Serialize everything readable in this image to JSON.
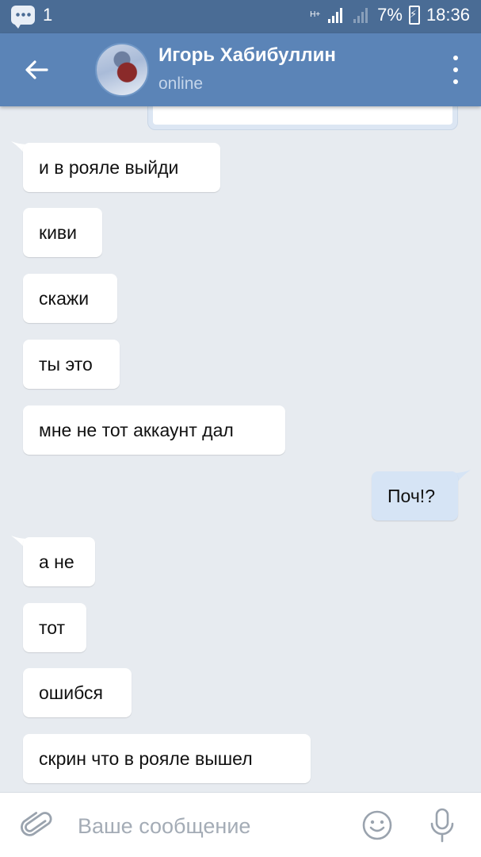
{
  "status_bar": {
    "notification_count": "1",
    "network_type": "H+",
    "battery": "7%",
    "time": "18:36"
  },
  "header": {
    "contact_name": "Игорь Хабибуллин",
    "contact_status": "online"
  },
  "messages": [
    {
      "side": "in",
      "text": "и в рояле выйди"
    },
    {
      "side": "in",
      "text": "киви"
    },
    {
      "side": "in",
      "text": "скажи"
    },
    {
      "side": "in",
      "text": "ты это"
    },
    {
      "side": "in",
      "text": "мне не тот аккаунт дал"
    },
    {
      "side": "out",
      "text": "Поч!?"
    },
    {
      "side": "in",
      "text": "а не"
    },
    {
      "side": "in",
      "text": "тот"
    },
    {
      "side": "in",
      "text": "ошибся"
    },
    {
      "side": "in",
      "text": "скрин что в рояле вышел"
    }
  ],
  "composer": {
    "placeholder": "Ваше сообщение"
  },
  "colors": {
    "status_bar": "#4a6c95",
    "toolbar": "#5b84b7",
    "chat_background": "#e7ebf0",
    "incoming_bubble": "#ffffff",
    "outgoing_bubble": "#d6e4f5"
  },
  "icons": [
    "chat-notification-icon",
    "signal-icon",
    "battery-icon",
    "back-arrow-icon",
    "more-vert-icon",
    "attach-icon",
    "emoji-icon",
    "mic-icon"
  ]
}
